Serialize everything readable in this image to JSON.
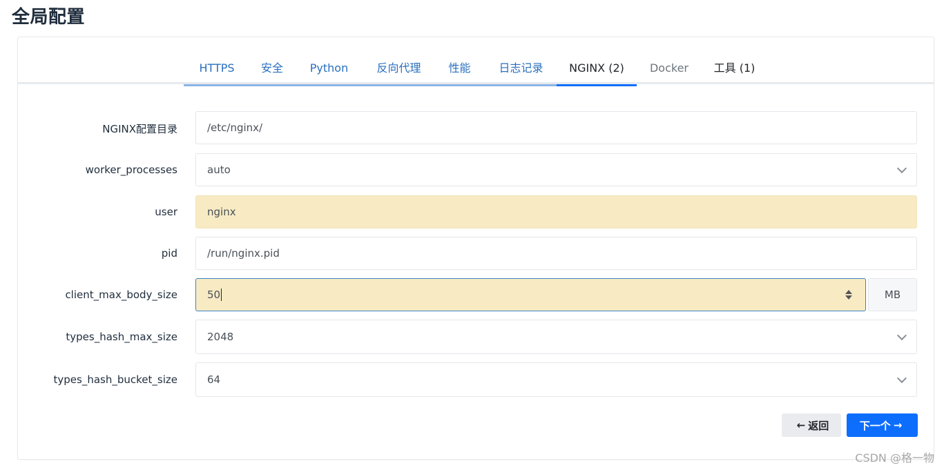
{
  "page": {
    "title": "全局配置"
  },
  "tabs": [
    {
      "label": "HTTPS",
      "state": "done"
    },
    {
      "label": "安全",
      "state": "done"
    },
    {
      "label": "Python",
      "state": "done"
    },
    {
      "label": "反向代理",
      "state": "done"
    },
    {
      "label": "性能",
      "state": "done"
    },
    {
      "label": "日志记录",
      "state": "done"
    },
    {
      "label": "NGINX (2)",
      "state": "active"
    },
    {
      "label": "Docker",
      "state": "muted"
    },
    {
      "label": "工具 (1)",
      "state": "dark"
    }
  ],
  "form": {
    "nginx_dir": {
      "label": "NGINX配置目录",
      "value": "/etc/nginx/"
    },
    "worker_processes": {
      "label": "worker_processes",
      "value": "auto"
    },
    "user": {
      "label": "user",
      "value": "nginx"
    },
    "pid": {
      "label": "pid",
      "value": "/run/nginx.pid"
    },
    "client_max_body_size": {
      "label": "client_max_body_size",
      "value": "50",
      "unit": "MB"
    },
    "types_hash_max_size": {
      "label": "types_hash_max_size",
      "value": "2048"
    },
    "types_hash_bucket_size": {
      "label": "types_hash_bucket_size",
      "value": "64"
    }
  },
  "buttons": {
    "back": {
      "label": "返回",
      "arrow": "←"
    },
    "next": {
      "label": "下一个",
      "arrow": "→"
    }
  },
  "watermark": "CSDN @格一物",
  "colors": {
    "accent": "#0d6efd",
    "highlight": "#f8ebc4",
    "tab_done": "#2a6fbe"
  }
}
